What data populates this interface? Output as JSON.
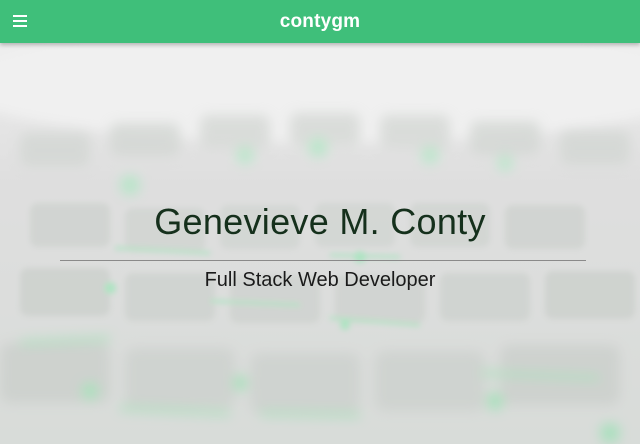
{
  "navbar": {
    "brand": "contygm",
    "menu_icon": "hamburger-menu-icon",
    "color": "#3fbf7a"
  },
  "hero": {
    "background_image": "blurred-keyboard-photo",
    "name": "Genevieve M. Conty",
    "tagline": "Full Stack Web Developer",
    "key_glow_color": "#3ddc7a"
  }
}
